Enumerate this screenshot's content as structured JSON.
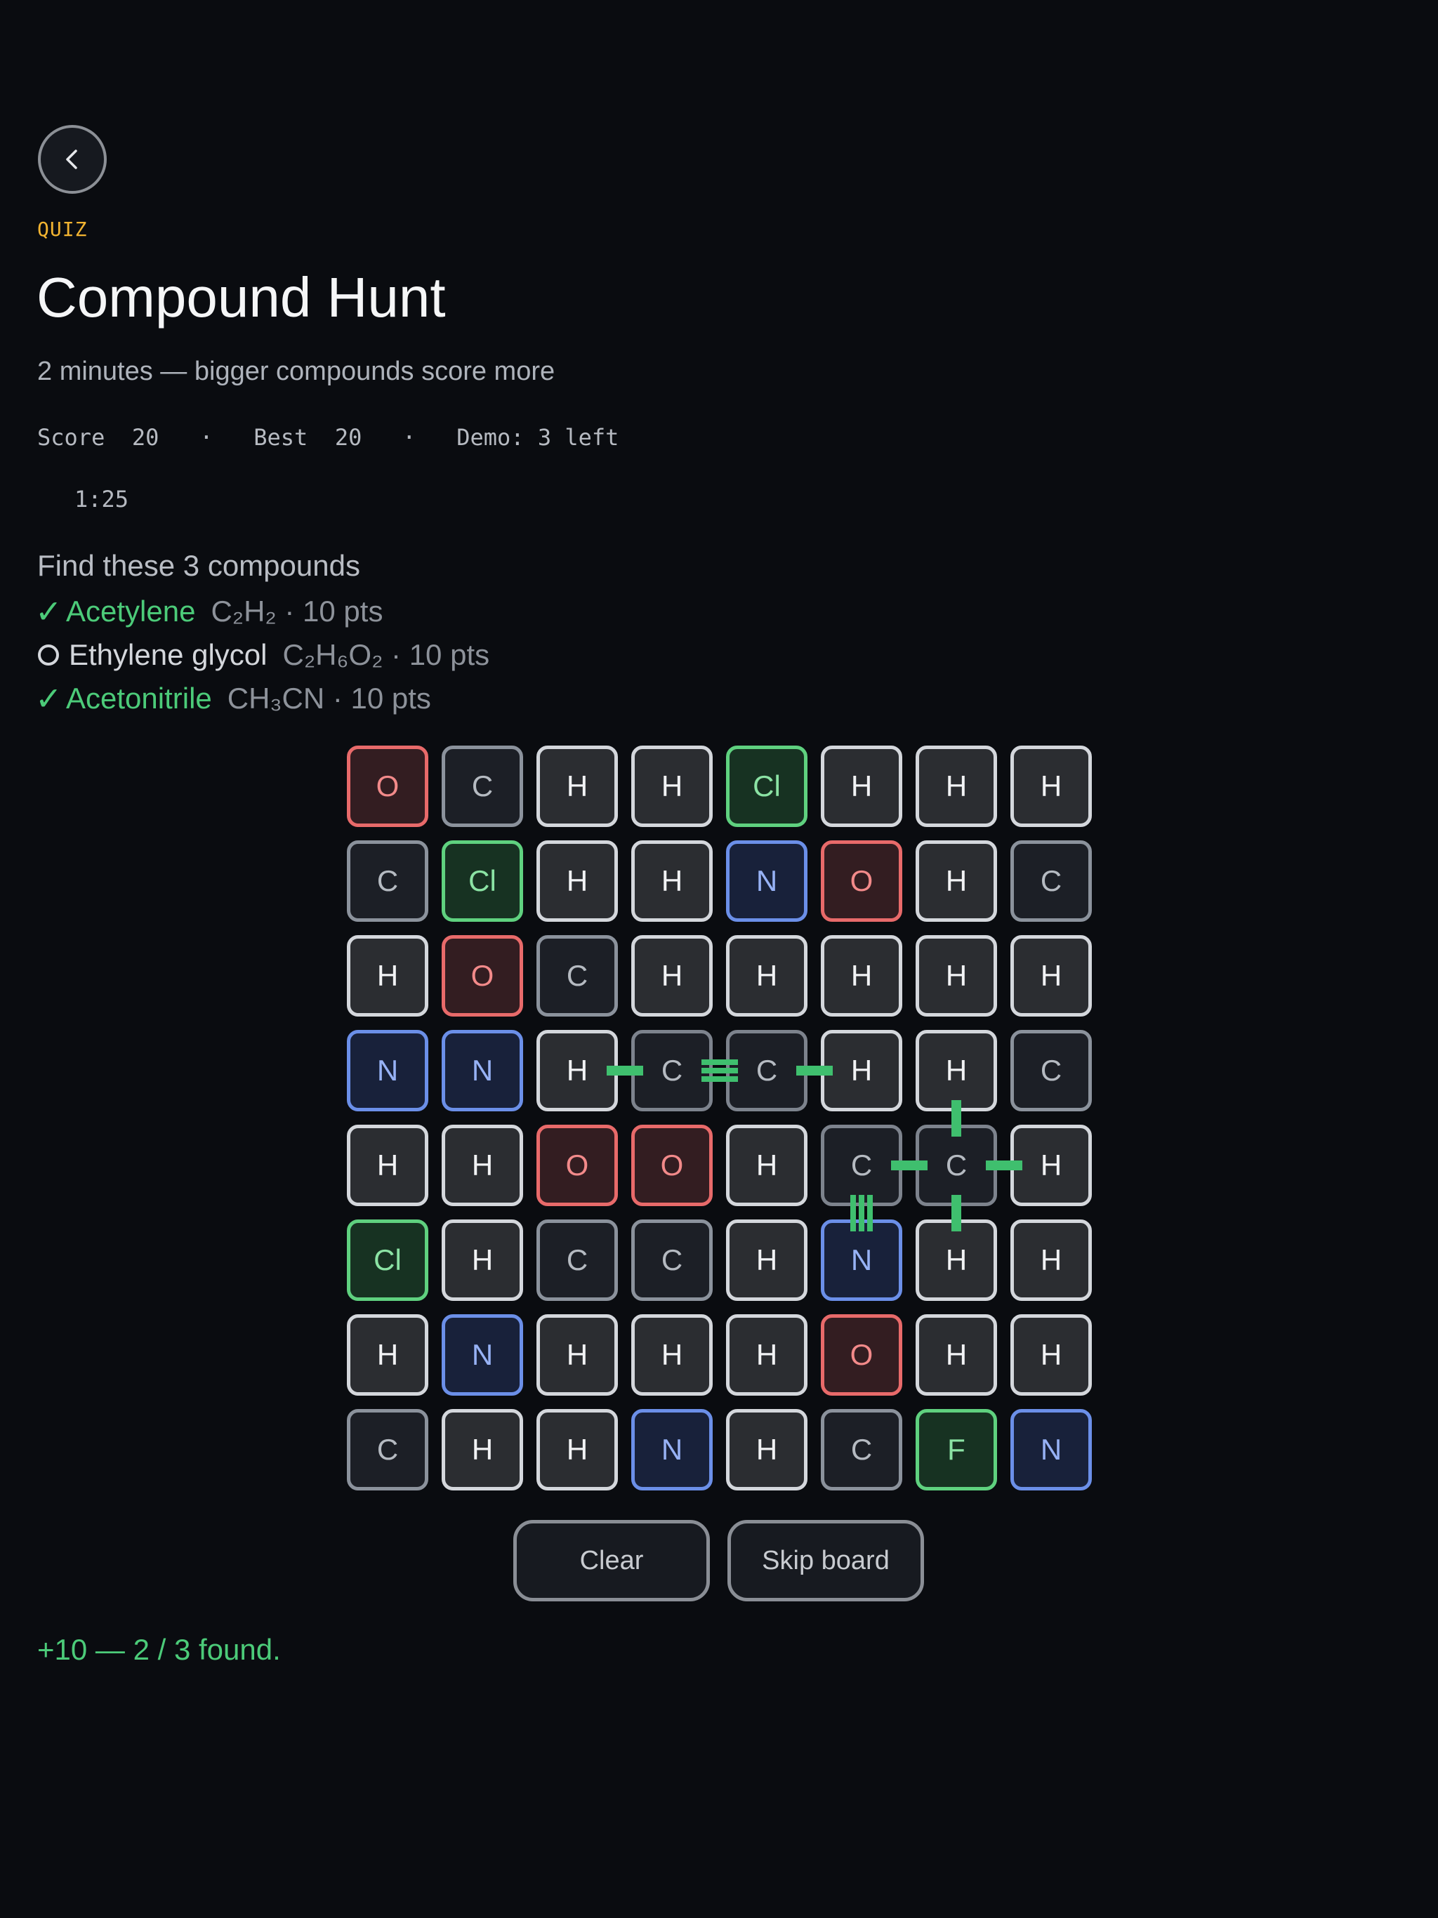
{
  "header": {
    "back_icon": "chevron-left-icon",
    "eyebrow": "QUIZ",
    "title": "Compound Hunt",
    "subtitle": "2 minutes — bigger compounds score more"
  },
  "stats": {
    "score_label": "Score",
    "score": "20",
    "sep": "·",
    "best_label": "Best",
    "best": "20",
    "demo": "Demo: 3 left"
  },
  "timer": "1:25",
  "targets": {
    "heading": "Find these 3 compounds",
    "items": [
      {
        "status": "found",
        "mark": "✓",
        "name": "Acetylene",
        "meta": "C₂H₂ · 10 pts"
      },
      {
        "status": "pending",
        "mark": "",
        "name": "Ethylene glycol",
        "meta": "C₂H₆O₂ · 10 pts"
      },
      {
        "status": "found",
        "mark": "✓",
        "name": "Acetonitrile",
        "meta": "CH₃CN · 10 pts"
      }
    ]
  },
  "board": {
    "rows": [
      [
        "O",
        "C",
        "H",
        "H",
        "Cl",
        "H",
        "H",
        "H"
      ],
      [
        "C",
        "Cl",
        "H",
        "H",
        "N",
        "O",
        "H",
        "C"
      ],
      [
        "H",
        "O",
        "C",
        "H",
        "H",
        "H",
        "H",
        "H"
      ],
      [
        "N",
        "N",
        "H",
        "C",
        "C",
        "H",
        "H",
        "C"
      ],
      [
        "H",
        "H",
        "O",
        "O",
        "H",
        "C",
        "C",
        "H"
      ],
      [
        "Cl",
        "H",
        "C",
        "C",
        "H",
        "N",
        "H",
        "H"
      ],
      [
        "H",
        "N",
        "H",
        "H",
        "H",
        "O",
        "H",
        "H"
      ],
      [
        "C",
        "H",
        "H",
        "N",
        "H",
        "C",
        "F",
        "N"
      ]
    ],
    "selected": [
      [
        3,
        3
      ],
      [
        3,
        4
      ],
      [
        4,
        5
      ],
      [
        4,
        6
      ]
    ],
    "bonds": [
      {
        "from": [
          3,
          2
        ],
        "to": [
          3,
          3
        ],
        "order": 1
      },
      {
        "from": [
          3,
          3
        ],
        "to": [
          3,
          4
        ],
        "order": 3
      },
      {
        "from": [
          3,
          4
        ],
        "to": [
          3,
          5
        ],
        "order": 1
      },
      {
        "from": [
          3,
          6
        ],
        "to": [
          4,
          6
        ],
        "order": 1
      },
      {
        "from": [
          4,
          5
        ],
        "to": [
          4,
          6
        ],
        "order": 1
      },
      {
        "from": [
          4,
          6
        ],
        "to": [
          4,
          7
        ],
        "order": 1
      },
      {
        "from": [
          4,
          5
        ],
        "to": [
          5,
          5
        ],
        "order": 3
      },
      {
        "from": [
          4,
          6
        ],
        "to": [
          5,
          6
        ],
        "order": 1
      }
    ],
    "colors": {
      "bond": "#3fbf6e"
    }
  },
  "actions": {
    "clear_label": "Clear",
    "skip_label": "Skip board"
  },
  "feedback": "+10 — 2 / 3 found."
}
